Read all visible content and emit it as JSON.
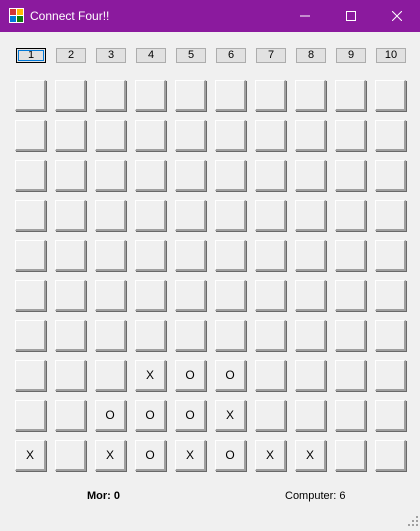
{
  "window": {
    "title": "Connect Four!!",
    "accent_color": "#8b1a9e",
    "icon": "app-grid-icon",
    "controls": [
      "minimize-icon",
      "maximize-icon",
      "close-icon"
    ]
  },
  "columns": [
    "1",
    "2",
    "3",
    "4",
    "5",
    "6",
    "7",
    "8",
    "9",
    "10"
  ],
  "focused_column": 0,
  "board": [
    [
      "",
      "",
      "",
      "",
      "",
      "",
      "",
      "",
      "",
      ""
    ],
    [
      "",
      "",
      "",
      "",
      "",
      "",
      "",
      "",
      "",
      ""
    ],
    [
      "",
      "",
      "",
      "",
      "",
      "",
      "",
      "",
      "",
      ""
    ],
    [
      "",
      "",
      "",
      "",
      "",
      "",
      "",
      "",
      "",
      ""
    ],
    [
      "",
      "",
      "",
      "",
      "",
      "",
      "",
      "",
      "",
      ""
    ],
    [
      "",
      "",
      "",
      "",
      "",
      "",
      "",
      "",
      "",
      ""
    ],
    [
      "",
      "",
      "",
      "",
      "",
      "",
      "",
      "",
      "",
      ""
    ],
    [
      "",
      "",
      "",
      "X",
      "O",
      "O",
      "",
      "",
      "",
      ""
    ],
    [
      "",
      "",
      "O",
      "O",
      "O",
      "X",
      "",
      "",
      "",
      ""
    ],
    [
      "X",
      "",
      "X",
      "O",
      "X",
      "O",
      "X",
      "X",
      "",
      ""
    ]
  ],
  "score": {
    "user_label": "Mor:",
    "user_value": "0",
    "computer_label": "Computer:",
    "computer_value": "6"
  }
}
